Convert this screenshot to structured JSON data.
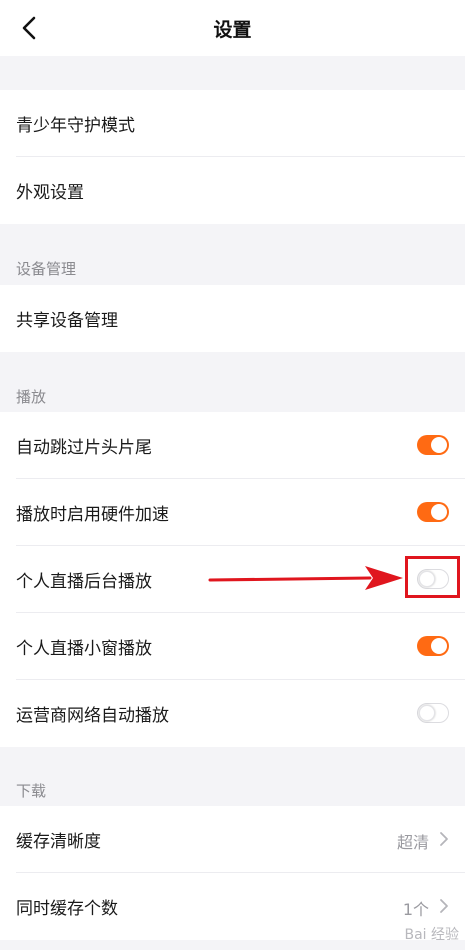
{
  "header": {
    "title": "设置"
  },
  "general": {
    "items": [
      {
        "label": "青少年守护模式"
      },
      {
        "label": "外观设置"
      }
    ]
  },
  "device_section": {
    "title": "设备管理",
    "items": [
      {
        "label": "共享设备管理"
      }
    ]
  },
  "playback_section": {
    "title": "播放",
    "items": [
      {
        "label": "自动跳过片头片尾",
        "toggle": true
      },
      {
        "label": "播放时启用硬件加速",
        "toggle": true
      },
      {
        "label": "个人直播后台播放",
        "toggle": false
      },
      {
        "label": "个人直播小窗播放",
        "toggle": true
      },
      {
        "label": "运营商网络自动播放",
        "toggle": false
      }
    ]
  },
  "download_section": {
    "title": "下载",
    "items": [
      {
        "label": "缓存清晰度",
        "value": "超清"
      },
      {
        "label": "同时缓存个数",
        "value": "1个"
      }
    ]
  },
  "colors": {
    "accent": "#ff6a13",
    "annotation": "#e0161e"
  },
  "watermark": "Bai 经验"
}
